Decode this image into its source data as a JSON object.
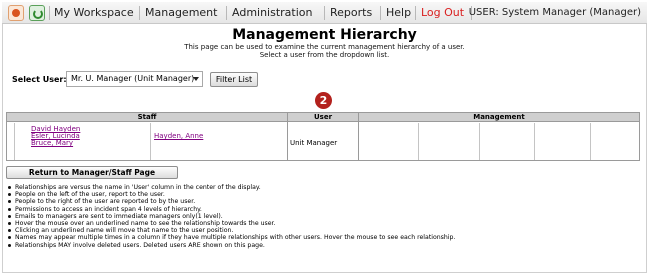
{
  "nav": {
    "items": [
      {
        "label": "My Workspace"
      },
      {
        "label": "Management"
      },
      {
        "label": "Administration"
      },
      {
        "label": "Reports"
      },
      {
        "label": "Help"
      },
      {
        "label": "Log Out"
      }
    ],
    "user_label": "USER: System Manager (Manager)",
    "logout_color": "#d91f1f",
    "icons": [
      "home-icon",
      "refresh-icon"
    ]
  },
  "page": {
    "title": "Management Hierarchy",
    "subtitle_line1": "This page can be used to examine the current management hierarchy of a user.",
    "subtitle_line2": "Select a user from the dropdown list."
  },
  "select": {
    "label": "Select User:",
    "value": "Mr. U. Manager (Unit Manager)",
    "filter_button": "Filter List"
  },
  "badge": {
    "text": "2",
    "color": "#b3211d"
  },
  "hierarchy": {
    "headers": {
      "staff": "Staff",
      "user": "User",
      "management": "Management"
    },
    "staff_column1": [
      "David Hayden",
      "Esler, Lucinda",
      "Bruce, Mary"
    ],
    "staff_column2": [
      "Hayden, Anne"
    ],
    "user_value": "Unit Manager"
  },
  "return_button": "Return to Manager/Staff Page",
  "notes": [
    "Relationships are versus the name in 'User' column in the center of the display.",
    "People on the left of the user, report to the user.",
    "People to the right of the user are reported to by the user.",
    "Permissions to access an incident span 4 levels of hierarchy.",
    "Emails to managers are sent to immediate managers only(1 level).",
    "Hover the mouse over an underlined name to see the relationship towards the user.",
    "Clicking an underlined name will move that name to the user position.",
    "Names may appear multiple times in a column if they have multiple relationships with other users. Hover the mouse to see each relationship.",
    "Relationships MAY involve deleted users. Deleted users ARE shown on this page."
  ]
}
